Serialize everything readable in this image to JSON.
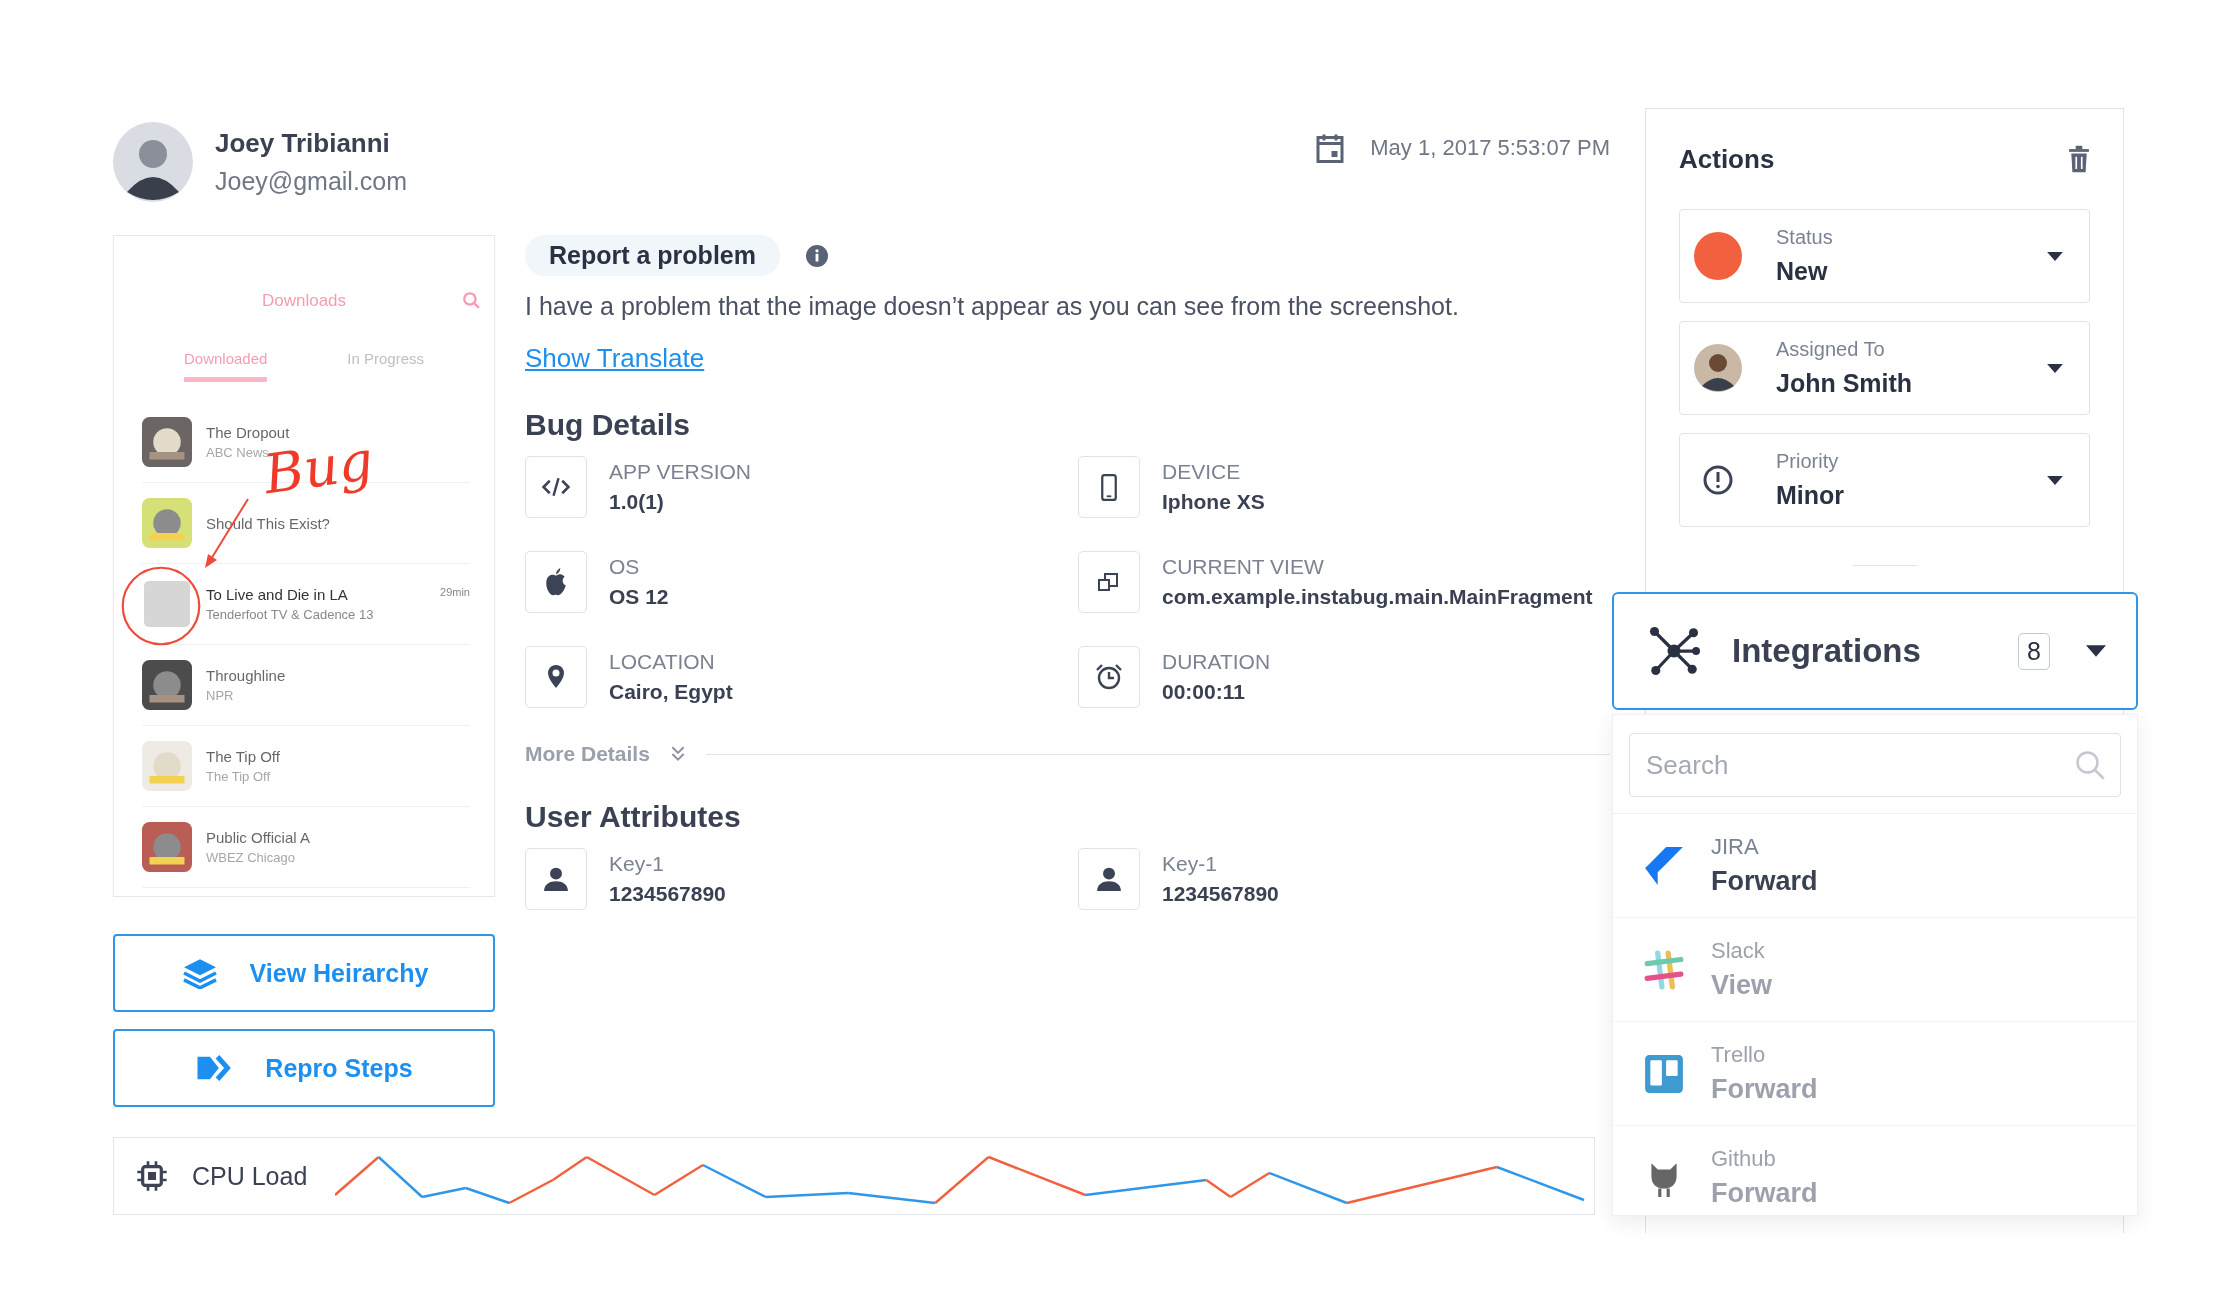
{
  "user": {
    "name": "Joey Tribianni",
    "email": "Joey@gmail.com"
  },
  "timestamp": "May 1, 2017 5:53:07 PM",
  "screenshot": {
    "header": "Downloads",
    "tabs": [
      {
        "label": "Downloaded",
        "selected": true
      },
      {
        "label": "In Progress",
        "selected": false
      }
    ],
    "episodes": [
      {
        "title": "The Dropout",
        "subtitle": "ABC News",
        "highlighted": false
      },
      {
        "title": "Should This Exist?",
        "highlighted": false
      },
      {
        "title": "To Live and Die in LA",
        "subtitle": "Tenderfoot TV & Cadence 13",
        "duration": "29min",
        "highlighted": true
      },
      {
        "title": "Throughline",
        "subtitle": "NPR",
        "highlighted": false
      },
      {
        "title": "The Tip Off",
        "subtitle": "The Tip Off",
        "highlighted": false
      },
      {
        "title": "Public Official A",
        "subtitle": "WBEZ Chicago",
        "highlighted": false
      }
    ],
    "annotation": "Bug"
  },
  "report": {
    "category": "Report a problem",
    "message": "I have a problem that the image doesn’t appear as you can see from the screenshot.",
    "link": "Show Translate"
  },
  "bug_details": {
    "title": "Bug Details",
    "items": [
      {
        "kind": "code",
        "label": "APP VERSION",
        "value": "1.0(1)"
      },
      {
        "kind": "phone",
        "label": "DEVICE",
        "value": "Iphone XS"
      },
      {
        "kind": "apple",
        "label": "OS",
        "value": "OS 12"
      },
      {
        "kind": "window",
        "label": "CURRENT VIEW",
        "value": "com.example.instabug.main.MainFragment"
      },
      {
        "kind": "pin",
        "label": "LOCATION",
        "value": "Cairo, Egypt"
      },
      {
        "kind": "alarm",
        "label": "DURATION",
        "value": "00:00:11"
      }
    ]
  },
  "more_details": "More Details",
  "user_attributes": {
    "title": "User Attributes",
    "items": [
      {
        "key": "Key-1",
        "value": "1234567890"
      },
      {
        "key": "Key-1",
        "value": "1234567890"
      }
    ]
  },
  "buttons": [
    {
      "kind": "layers",
      "label": "View Heirarchy"
    },
    {
      "kind": "steps",
      "label": "Repro Steps"
    }
  ],
  "cpu": {
    "label": "CPU Load"
  },
  "actions": {
    "title": "Actions",
    "fields": [
      {
        "kind": "status",
        "label": "Status",
        "value": "New",
        "color": "#f2613f"
      },
      {
        "kind": "avatar",
        "label": "Assigned To",
        "value": "John Smith"
      },
      {
        "kind": "priority",
        "label": "Priority",
        "value": "Minor"
      }
    ]
  },
  "integrations": {
    "title": "Integrations",
    "count": "8",
    "expanded": true,
    "search": {
      "placeholder": "Search"
    },
    "items": [
      {
        "kind": "jira",
        "name": "JIRA",
        "action": "Forward",
        "disabled": false
      },
      {
        "kind": "slack",
        "name": "Slack",
        "action": "View",
        "disabled": true
      },
      {
        "kind": "trello",
        "name": "Trello",
        "action": "Forward",
        "disabled": true
      },
      {
        "kind": "github",
        "name": "Github",
        "action": "Forward",
        "disabled": true
      }
    ]
  }
}
